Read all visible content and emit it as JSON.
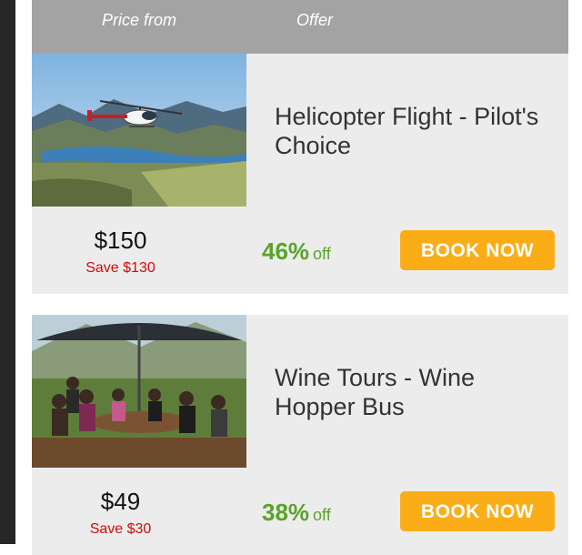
{
  "header": {
    "price_label": "Price from",
    "offer_label": "Offer"
  },
  "deals": [
    {
      "title": "Helicopter Flight - Pilot's Choice",
      "price": "$150",
      "save": "Save $130",
      "discount": "46%",
      "off": "off",
      "button": "BOOK NOW"
    },
    {
      "title": "Wine Tours - Wine Hopper Bus",
      "price": "$49",
      "save": "Save $30",
      "discount": "38%",
      "off": "off",
      "button": "BOOK NOW"
    }
  ],
  "colors": {
    "header_bg": "#a3a3a3",
    "card_bg": "#ececec",
    "save_red": "#d20a0a",
    "discount_green": "#5aa32a",
    "button_orange": "#fbad18"
  },
  "icons": [
    "helicopter-photo",
    "wine-tour-photo"
  ]
}
